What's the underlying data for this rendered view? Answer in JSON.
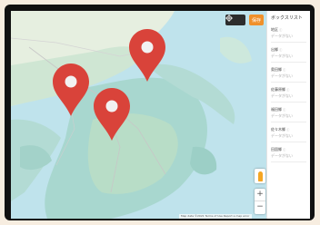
{
  "map": {
    "locate_icon": "crosshair-icon",
    "save_label": "保存",
    "attribution": "Map data ©2021  Terms of Use  Report a map error",
    "zoom_in": "+",
    "zoom_out": "−",
    "colors": {
      "water": "#bfe3ec",
      "land": "#a8d7cf",
      "pin": "#d9433a",
      "locate": "#2d2d2d",
      "save": "#f0902a"
    }
  },
  "panel": {
    "title": "ボックスリスト",
    "items": [
      {
        "name": "地区",
        "sub": "データがない"
      },
      {
        "name": "出郷",
        "sub": "データがない"
      },
      {
        "name": "奥田郷",
        "sub": "データがない"
      },
      {
        "name": "佐藤原郷",
        "sub": "データがない"
      },
      {
        "name": "福田郷",
        "sub": "データがない"
      },
      {
        "name": "佐々木郷",
        "sub": "データがない"
      },
      {
        "name": "田園郷",
        "sub": "データがない"
      }
    ]
  }
}
